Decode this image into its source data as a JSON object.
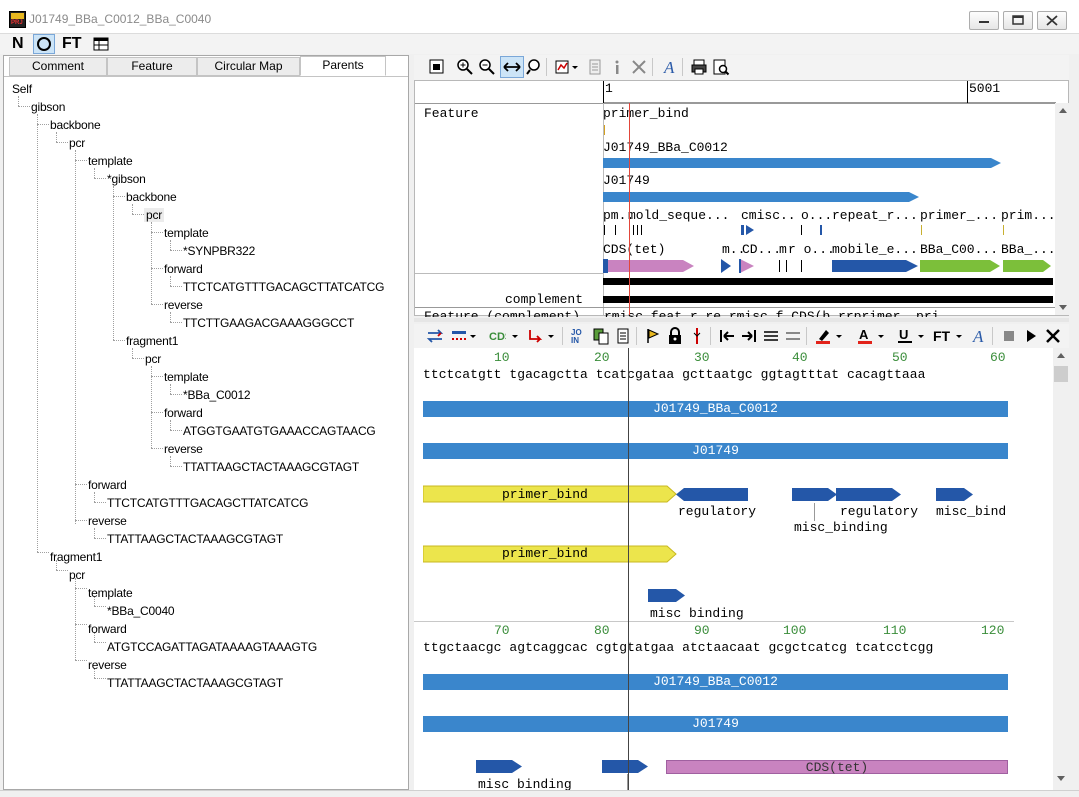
{
  "window": {
    "title": "J01749_BBa_C0012_BBa_C0040"
  },
  "appbar": {
    "n_label": "N",
    "ft_label": "FT"
  },
  "tabs": [
    "Comment",
    "Feature",
    "Circular Map",
    "Parents"
  ],
  "tree": {
    "nodes": [
      "Self",
      "gibson",
      "backbone",
      "pcr",
      "template",
      "*gibson",
      "backbone",
      "pcr",
      "template",
      "*SYNPBR322",
      "forward",
      "TTCTCATGTTTGACAGCTTATCATCG",
      "reverse",
      "TTCTTGAAGACGAAAGGGCCT",
      "fragment1",
      "pcr",
      "template",
      "*BBa_C0012",
      "forward",
      "ATGGTGAATGTGAAACCAGTAACG",
      "reverse",
      "TTATTAAGCTACTAAAGCGTAGT",
      "forward",
      "TTCTCATGTTTGACAGCTTATCATCG",
      "reverse",
      "TTATTAAGCTACTAAAGCGTAGT",
      "fragment1",
      "pcr",
      "template",
      "*BBa_C0040",
      "forward",
      "ATGTCCAGATTAGATAAAAGTAAAGTG",
      "reverse",
      "TTATTAAGCTACTAAAGCGTAGT"
    ]
  },
  "map": {
    "ruler": {
      "start": "1",
      "mark": "5001"
    },
    "feature_header": "Feature",
    "complement_label": "complement",
    "complement_header": "Feature (complement)",
    "complement_header_tail": "rmisc_feat  r re  rmisc f  CDS(b   rrprimer_  pri",
    "rows": {
      "primer_bind": "primer_bind",
      "construct": "J01749_BBa_C0012",
      "j01749": "J01749",
      "row4": [
        "pm..",
        "mold_seque...",
        "cmisc..",
        "o...",
        "repeat_r...",
        "primer_...",
        "prim..."
      ],
      "row5": [
        "CDS(tet)",
        "m..",
        "CD...",
        "m",
        "r o...",
        "mobile_e...",
        "BBa_C00...",
        "BBa_..."
      ]
    }
  },
  "seq_block1": {
    "numbers": [
      "10",
      "20",
      "30",
      "40",
      "50",
      "60"
    ],
    "sequence": "ttctcatgtt tgacagctta tcatcgataa gcttaatgc ggtagtttat cacagttaaa",
    "bars": {
      "construct": "J01749_BBa_C0012",
      "j01749": "J01749"
    },
    "features": {
      "primer_bind_1": "primer_bind",
      "regulatory_1": "regulatory",
      "misc_binding_1": "misc_binding",
      "regulatory_2": "regulatory",
      "misc_bind_trunc": "misc_bind",
      "primer_bind_2": "primer_bind",
      "misc_binding_2": "misc binding"
    }
  },
  "seq_block2": {
    "numbers": [
      "70",
      "80",
      "90",
      "100",
      "110",
      "120"
    ],
    "sequence": "ttgctaacgc agtcaggcac cgtgtatgaa atctaacaat gcgctcatcg tcatcctcgg",
    "bars": {
      "construct": "J01749_BBa_C0012",
      "j01749": "J01749",
      "cds": "CDS(tet)"
    },
    "features": {
      "misc_binding": "misc binding"
    }
  },
  "colors": {
    "blue_bar": "#3a86cc",
    "dark_blue_arrow": "#2457a8",
    "yellow_primer": "#ece54c",
    "green_feature": "#7cbf3a",
    "pink_cds": "#c983c0"
  }
}
